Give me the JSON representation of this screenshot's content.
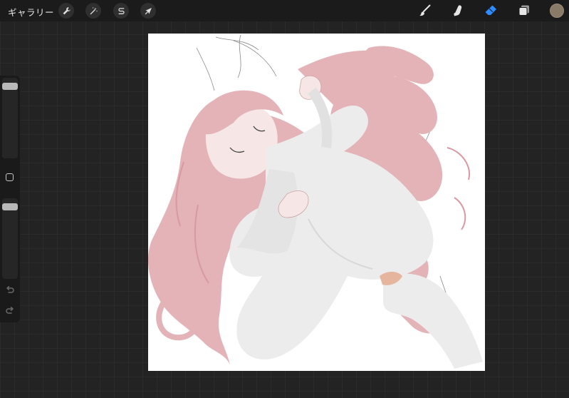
{
  "topbar": {
    "gallery_label": "ギャラリー",
    "left_tools": [
      {
        "name": "actions",
        "icon": "wrench-icon"
      },
      {
        "name": "adjustments",
        "icon": "magic-wand-icon"
      },
      {
        "name": "selection",
        "icon": "selection-s-icon"
      },
      {
        "name": "transform",
        "icon": "arrow-cursor-icon"
      }
    ],
    "right_tools": [
      {
        "name": "brush",
        "icon": "brush-icon"
      },
      {
        "name": "smudge",
        "icon": "smudge-finger-icon"
      },
      {
        "name": "eraser",
        "icon": "eraser-icon",
        "active": true
      },
      {
        "name": "layers",
        "icon": "layers-icon"
      }
    ],
    "current_color": "#8a7b68",
    "active_tool_color": "#2f8cff"
  },
  "sidebar": {
    "brush_size_level": 0.05,
    "opacity_level": 0.05
  },
  "canvas": {
    "background": "#ffffff",
    "hair_color": "#e3b3b8",
    "dress_color": "#ececec"
  }
}
